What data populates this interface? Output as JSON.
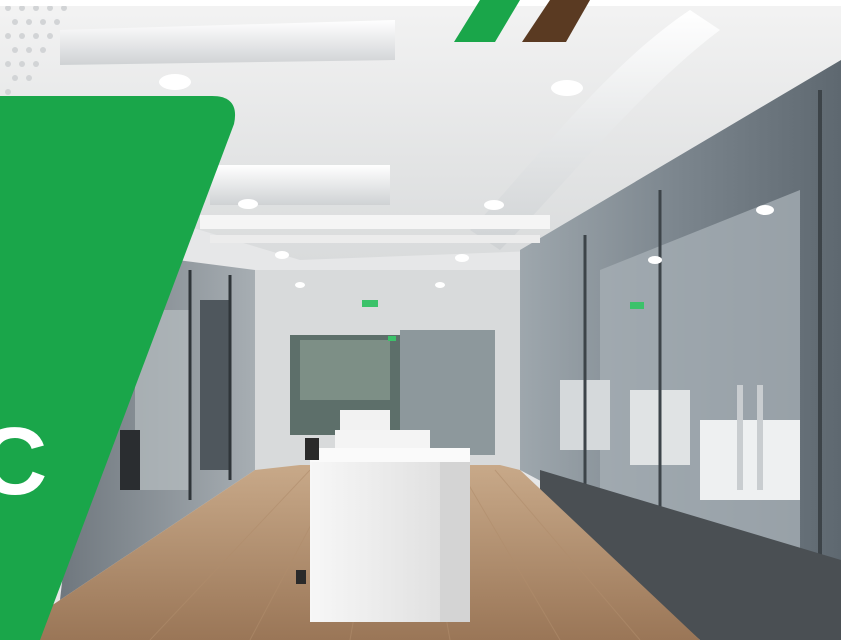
{
  "banner": {
    "text": "C",
    "color": "#1aa64a"
  },
  "top_accents": {
    "green": "#1aa64a",
    "brown": "#5a3a22"
  },
  "scene": {
    "subject": "office-corridor-photo"
  }
}
